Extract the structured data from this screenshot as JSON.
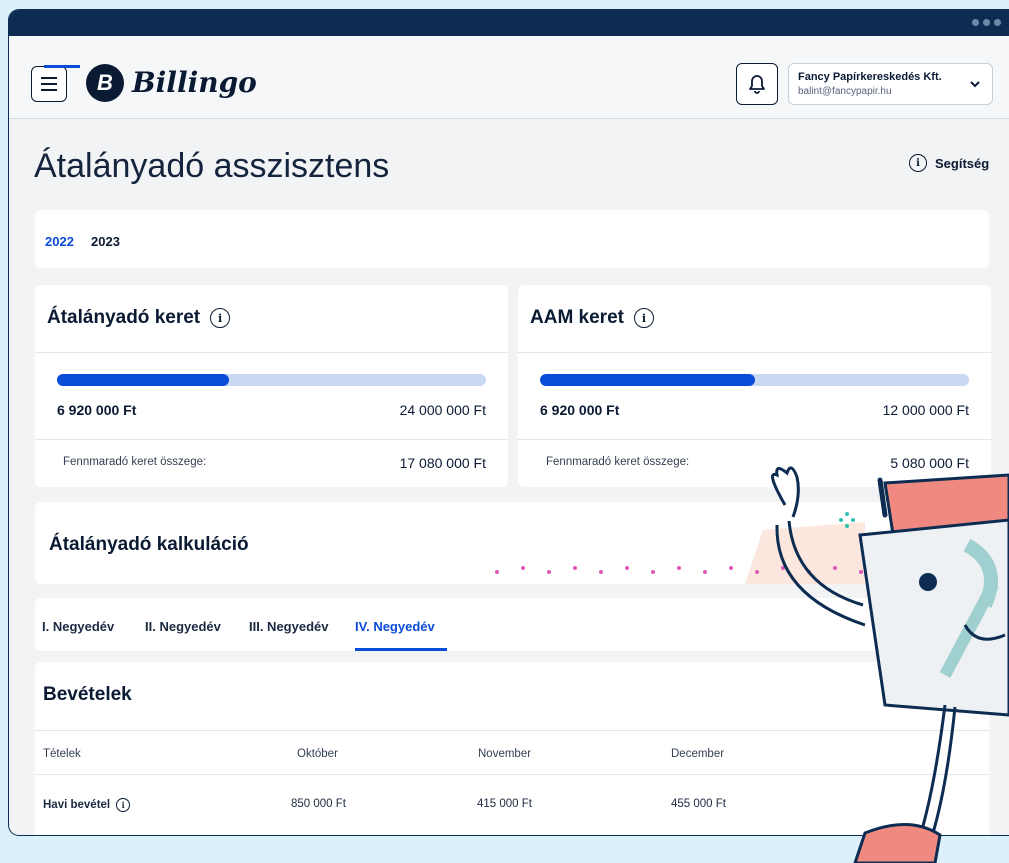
{
  "brand": {
    "logo_letter": "B",
    "name": "Billingo"
  },
  "account": {
    "company": "Fancy Papírkereskedés Kft.",
    "email": "balint@fancypapir.hu"
  },
  "page": {
    "title": "Átalányadó asszisztens",
    "help_label": "Segítség"
  },
  "year_tabs": [
    {
      "label": "2022",
      "active": true
    },
    {
      "label": "2023",
      "active": false
    }
  ],
  "limits": [
    {
      "title": "Átalányadó keret",
      "used": "6 920 000 Ft",
      "limit": "24 000 000 Ft",
      "progress_fraction": 0.4,
      "remaining_label": "Fennmaradó keret összege:",
      "remaining": "17 080 000 Ft"
    },
    {
      "title": "AAM keret",
      "used": "6 920 000 Ft",
      "limit": "12 000 000 Ft",
      "progress_fraction": 0.5,
      "remaining_label": "Fennmaradó keret összege:",
      "remaining": "5 080 000 Ft"
    }
  ],
  "calculation": {
    "title": "Átalányadó kalkuláció"
  },
  "quarters": [
    {
      "label": "I. Negyedév",
      "active": false
    },
    {
      "label": "II. Negyedév",
      "active": false
    },
    {
      "label": "III. Negyedév",
      "active": false
    },
    {
      "label": "IV. Negyedév",
      "active": true
    }
  ],
  "revenue": {
    "title": "Bevételek",
    "columns": [
      "Tételek",
      "Október",
      "November",
      "December"
    ],
    "row": {
      "label": "Havi bevétel",
      "values": [
        "850 000 Ft",
        "415 000 Ft",
        "455 000 Ft"
      ]
    }
  },
  "colors": {
    "accent": "#0a4bd8",
    "navy": "#0d2c52",
    "progress_track": "#c9d9f2",
    "mascot_pink": "#f08a80"
  },
  "icons": {
    "menu": "menu-icon",
    "bell": "bell-icon",
    "chevron": "chevron-down-icon",
    "info": "info-icon"
  }
}
